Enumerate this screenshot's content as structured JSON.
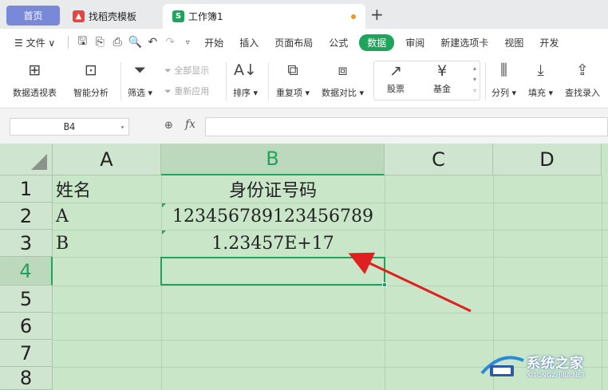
{
  "tabs": {
    "home": "首页",
    "template": "找稻壳模板",
    "workbook": "工作簿1",
    "new_tab": "+"
  },
  "menu": {
    "file": "文件",
    "items": [
      "开始",
      "插入",
      "页面布局",
      "公式",
      "数据",
      "审阅",
      "新建选项卡",
      "视图",
      "开发"
    ],
    "active": "数据"
  },
  "ribbon": {
    "pivot": "数据透视表",
    "smart": "智能分析",
    "filter": "筛选",
    "show_all": "全部显示",
    "reapply": "重新应用",
    "sort": "排序",
    "duplicates": "重复项",
    "compare": "数据对比",
    "stock": "股票",
    "fund": "基金",
    "split": "分列",
    "fill": "填充",
    "lookup": "查找录入"
  },
  "formula_bar": {
    "cell_ref": "B4",
    "fx": "fx",
    "value": ""
  },
  "sheet": {
    "columns": [
      "A",
      "B",
      "C",
      "D"
    ],
    "selected_column": "B",
    "rows": [
      "1",
      "2",
      "3",
      "4",
      "5",
      "6",
      "7",
      "8"
    ],
    "selected_row": "4",
    "cells": {
      "A1": "姓名",
      "B1": "身份证号码",
      "A2": "A",
      "B2": "123456789123456789",
      "A3": "B",
      "B3": "1.23457E+17"
    }
  },
  "colors": {
    "accent": "#1ea55b",
    "grid_bg": "#c9e6c8",
    "arrow": "#e02020"
  },
  "watermark": {
    "title": "系统之家",
    "url": "XITONGZHIJIA.NET"
  }
}
